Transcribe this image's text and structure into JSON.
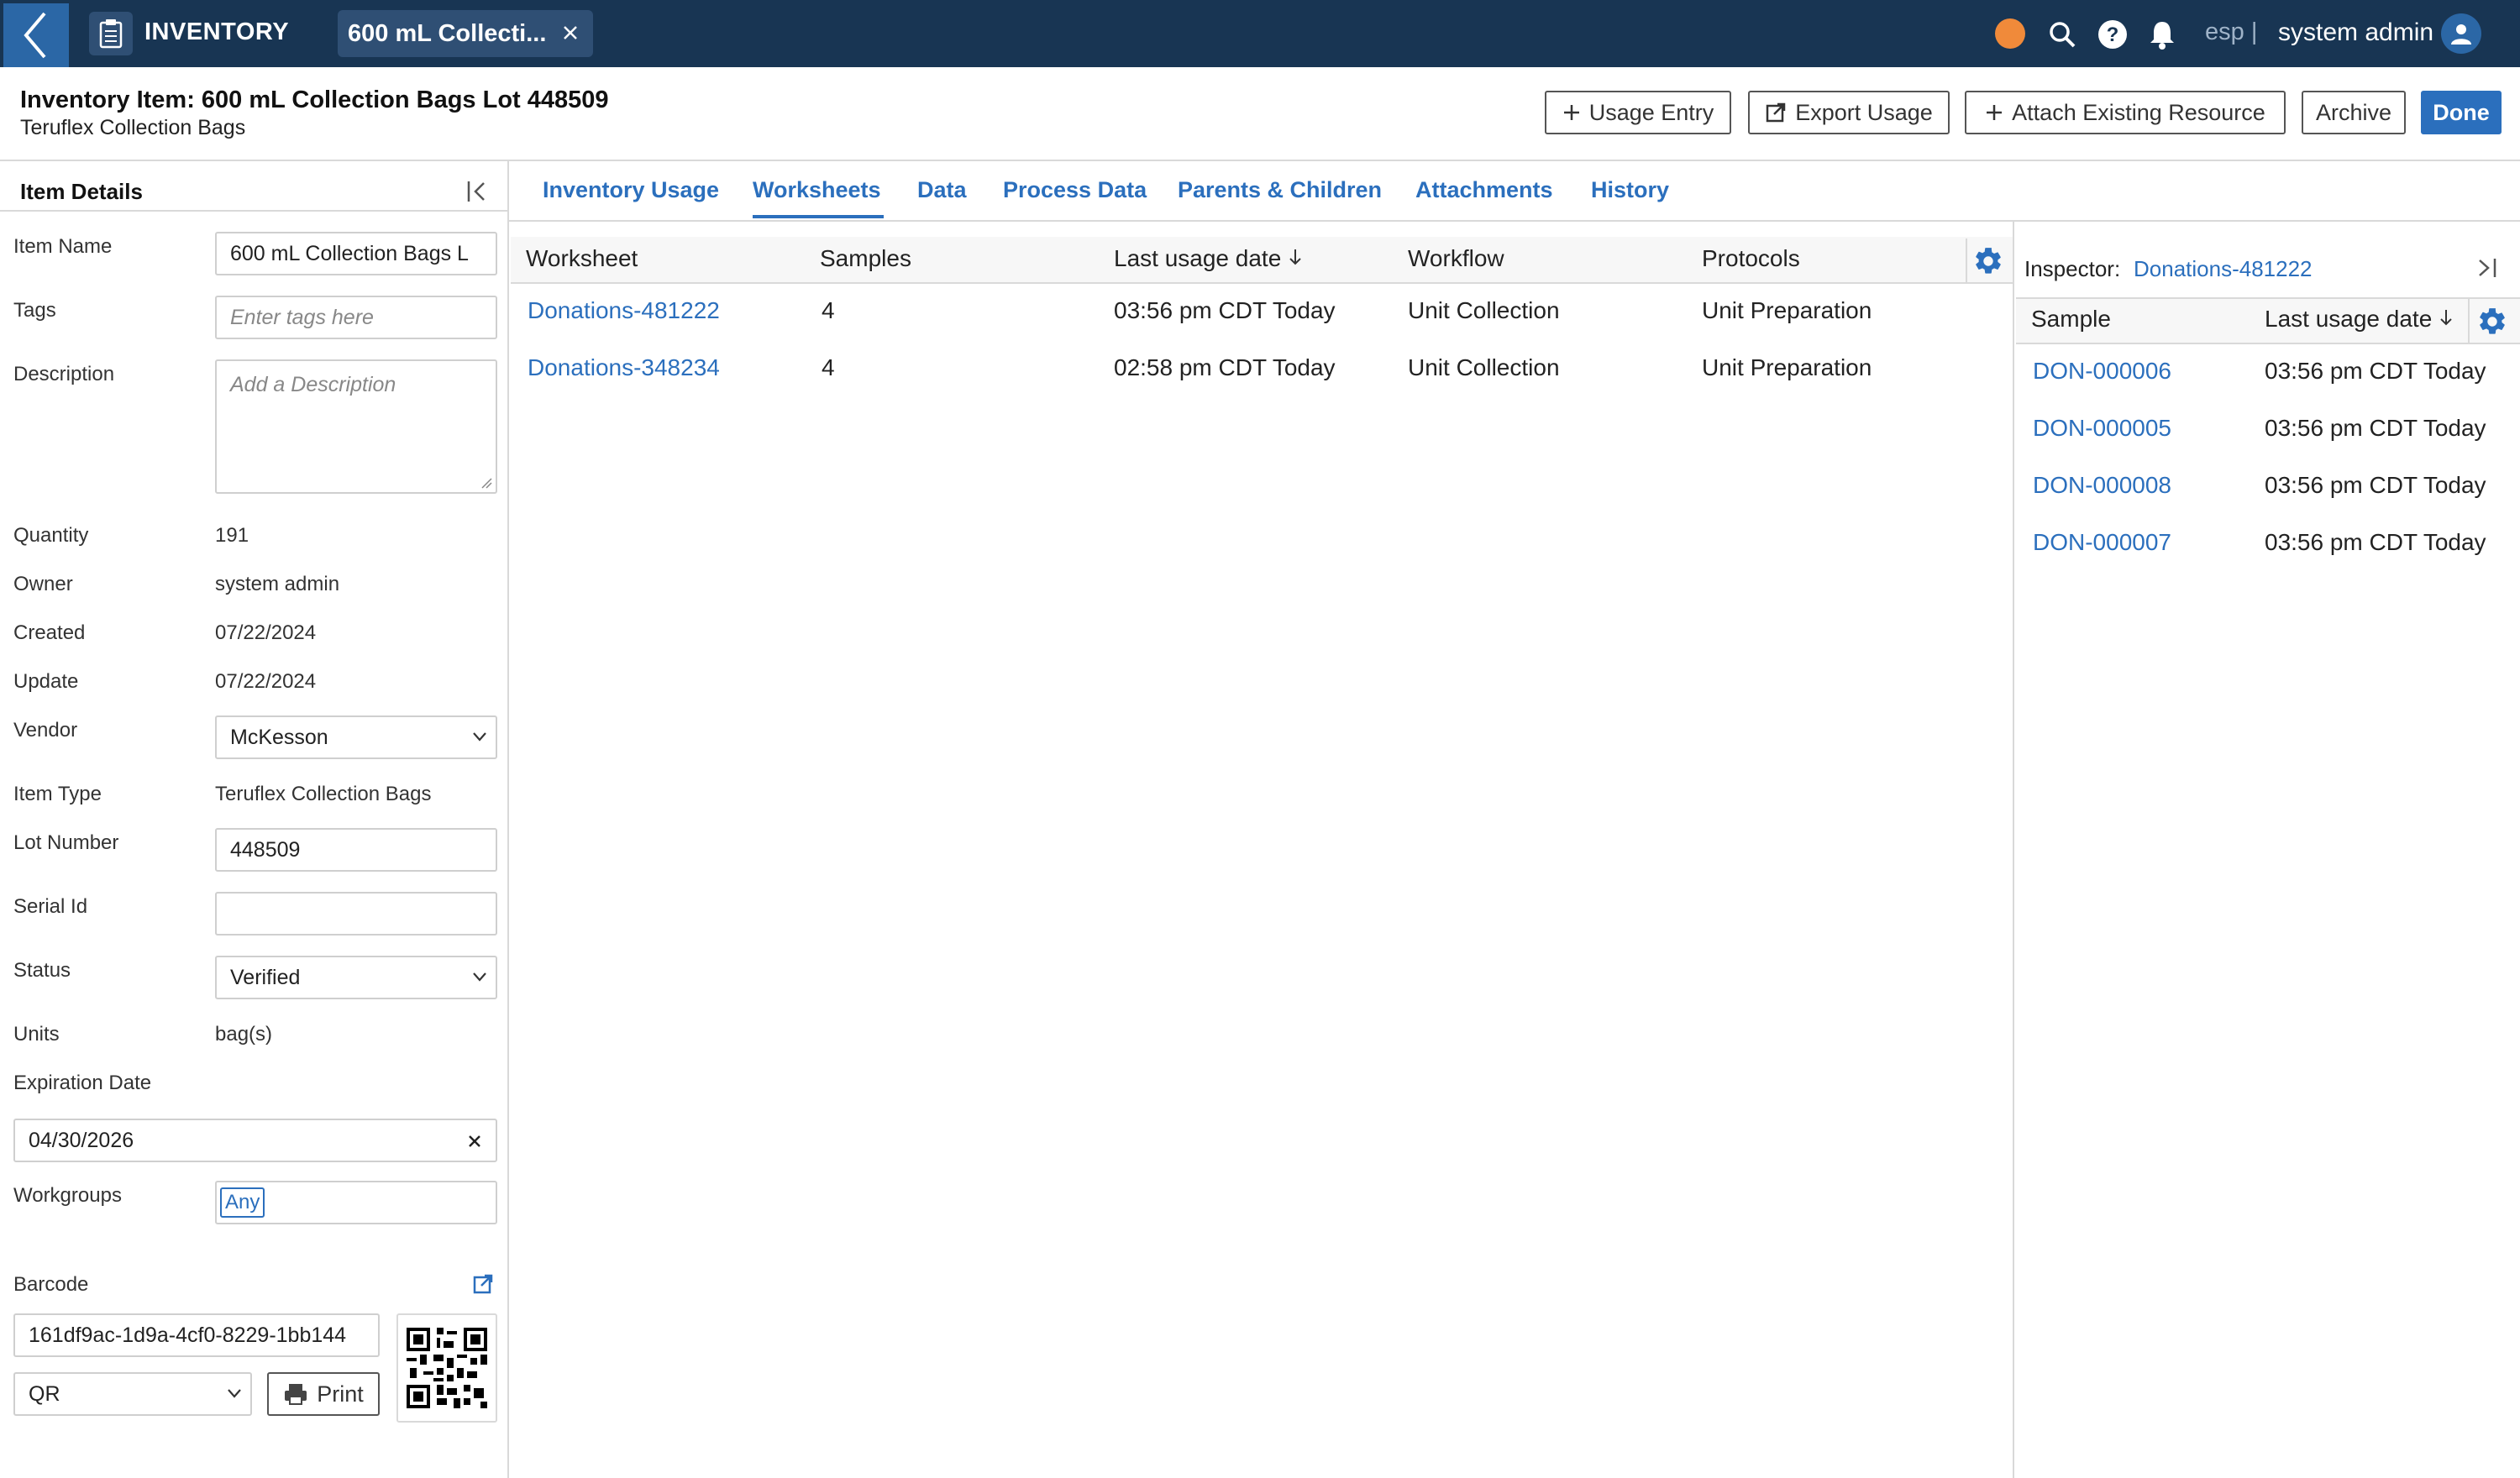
{
  "nav": {
    "app_name": "INVENTORY",
    "tab_label": "600 mL Collecti...",
    "lang": "esp |",
    "user": "system admin",
    "icons": [
      "back-chevron-icon",
      "clipboard-icon",
      "close-icon",
      "status-dot",
      "search-icon",
      "help-icon",
      "bell-icon",
      "user-avatar-icon"
    ],
    "status_color": "#f08a3a"
  },
  "header": {
    "title": "Inventory Item: 600 mL Collection Bags Lot 448509",
    "subtitle": "Teruflex Collection Bags",
    "buttons": {
      "usage_entry": "Usage Entry",
      "export_usage": "Export Usage",
      "attach_resource": "Attach Existing Resource",
      "archive": "Archive",
      "done": "Done"
    }
  },
  "details": {
    "title": "Item Details",
    "item_name_label": "Item Name",
    "item_name_value": "600 mL Collection Bags L",
    "tags_label": "Tags",
    "tags_placeholder": "Enter tags here",
    "description_label": "Description",
    "description_placeholder": "Add a Description",
    "quantity_label": "Quantity",
    "quantity_value": "191",
    "owner_label": "Owner",
    "owner_value": "system admin",
    "created_label": "Created",
    "created_value": "07/22/2024",
    "update_label": "Update",
    "update_value": "07/22/2024",
    "vendor_label": "Vendor",
    "vendor_value": "McKesson",
    "item_type_label": "Item Type",
    "item_type_value": "Teruflex Collection Bags",
    "lot_label": "Lot Number",
    "lot_value": "448509",
    "serial_label": "Serial Id",
    "serial_value": "",
    "status_label": "Status",
    "status_value": "Verified",
    "units_label": "Units",
    "units_value": "bag(s)",
    "expiration_label": "Expiration Date",
    "expiration_value": "04/30/2026",
    "workgroups_label": "Workgroups",
    "workgroup_chip": "Any",
    "barcode_label": "Barcode",
    "barcode_value": "161df9ac-1d9a-4cf0-8229-1bb144",
    "barcode_type": "QR",
    "print_label": "Print"
  },
  "tabs": [
    "Inventory Usage",
    "Worksheets",
    "Data",
    "Process Data",
    "Parents & Children",
    "Attachments",
    "History"
  ],
  "active_tab": "Worksheets",
  "worksheets": {
    "columns": [
      "Worksheet",
      "Samples",
      "Last usage date",
      "Workflow",
      "Protocols"
    ],
    "rows": [
      {
        "worksheet": "Donations-481222",
        "samples": "4",
        "last_usage": "03:56 pm CDT Today",
        "workflow": "Unit Collection",
        "protocols": "Unit Preparation"
      },
      {
        "worksheet": "Donations-348234",
        "samples": "4",
        "last_usage": "02:58 pm CDT Today",
        "workflow": "Unit Collection",
        "protocols": "Unit Preparation"
      }
    ]
  },
  "inspector": {
    "label": "Inspector:",
    "target": "Donations-481222",
    "columns": [
      "Sample",
      "Last usage date"
    ],
    "rows": [
      {
        "sample": "DON-000006",
        "date": "03:56 pm CDT Today"
      },
      {
        "sample": "DON-000005",
        "date": "03:56 pm CDT Today"
      },
      {
        "sample": "DON-000008",
        "date": "03:56 pm CDT Today"
      },
      {
        "sample": "DON-000007",
        "date": "03:56 pm CDT Today"
      }
    ]
  },
  "colors": {
    "nav_bg": "#183553",
    "accent": "#2b6fbd",
    "link": "#2b6fbd"
  }
}
